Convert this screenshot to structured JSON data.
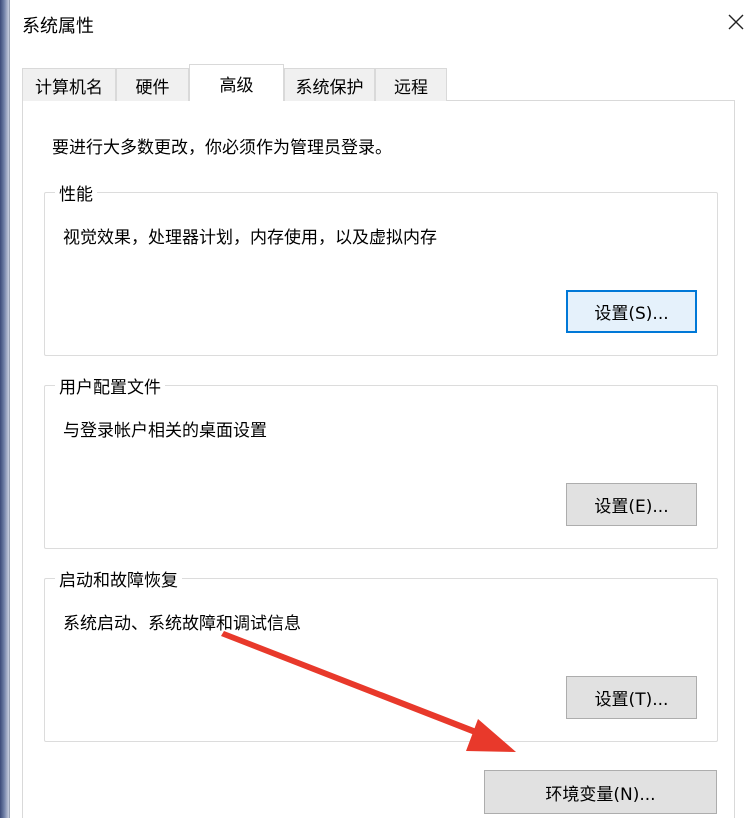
{
  "window": {
    "title": "系统属性"
  },
  "tabs": [
    {
      "label": "计算机名"
    },
    {
      "label": "硬件"
    },
    {
      "label": "高级"
    },
    {
      "label": "系统保护"
    },
    {
      "label": "远程"
    }
  ],
  "advanced": {
    "notice": "要进行大多数更改，你必须作为管理员登录。",
    "groups": [
      {
        "title": "性能",
        "description": "视觉效果，处理器计划，内存使用，以及虚拟内存",
        "button": "设置(S)..."
      },
      {
        "title": "用户配置文件",
        "description": "与登录帐户相关的桌面设置",
        "button": "设置(E)..."
      },
      {
        "title": "启动和故障恢复",
        "description": "系统启动、系统故障和调试信息",
        "button": "设置(T)..."
      }
    ],
    "env_button": "环境变量(N)..."
  },
  "colors": {
    "focus_border": "#0078d7",
    "annotation_arrow": "#e8392b",
    "button_face": "#e1e1e1"
  },
  "icons": {
    "close": "close-icon"
  }
}
